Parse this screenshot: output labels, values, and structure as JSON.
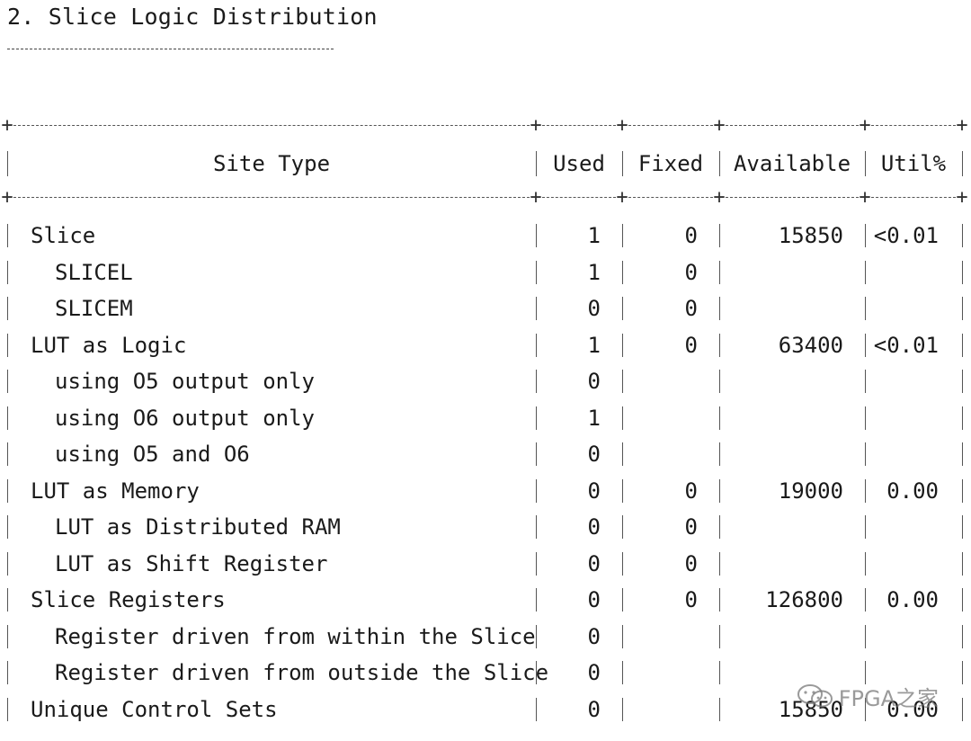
{
  "section": {
    "title": "2. Slice Logic Distribution"
  },
  "table": {
    "headers": {
      "site_type": "Site Type",
      "used": "Used",
      "fixed": "Fixed",
      "available": "Available",
      "util": "Util%"
    },
    "rows": [
      {
        "name": "Slice",
        "indent": false,
        "used": "1",
        "fixed": "0",
        "available": "15850",
        "util": "<0.01"
      },
      {
        "name": "SLICEL",
        "indent": true,
        "used": "1",
        "fixed": "0",
        "available": "",
        "util": ""
      },
      {
        "name": "SLICEM",
        "indent": true,
        "used": "0",
        "fixed": "0",
        "available": "",
        "util": ""
      },
      {
        "name": "LUT as Logic",
        "indent": false,
        "used": "1",
        "fixed": "0",
        "available": "63400",
        "util": "<0.01"
      },
      {
        "name": "using O5 output only",
        "indent": true,
        "used": "0",
        "fixed": "",
        "available": "",
        "util": ""
      },
      {
        "name": "using O6 output only",
        "indent": true,
        "used": "1",
        "fixed": "",
        "available": "",
        "util": ""
      },
      {
        "name": "using O5 and O6",
        "indent": true,
        "used": "0",
        "fixed": "",
        "available": "",
        "util": ""
      },
      {
        "name": "LUT as Memory",
        "indent": false,
        "used": "0",
        "fixed": "0",
        "available": "19000",
        "util": "0.00"
      },
      {
        "name": "LUT as Distributed RAM",
        "indent": true,
        "used": "0",
        "fixed": "0",
        "available": "",
        "util": ""
      },
      {
        "name": "LUT as Shift Register",
        "indent": true,
        "used": "0",
        "fixed": "0",
        "available": "",
        "util": ""
      },
      {
        "name": "Slice Registers",
        "indent": false,
        "used": "0",
        "fixed": "0",
        "available": "126800",
        "util": "0.00"
      },
      {
        "name": "Register driven from within the Slice",
        "indent": true,
        "used": "0",
        "fixed": "",
        "available": "",
        "util": ""
      },
      {
        "name": "Register driven from outside the Slice",
        "indent": true,
        "used": "0",
        "fixed": "",
        "available": "",
        "util": ""
      },
      {
        "name": "Unique Control Sets",
        "indent": false,
        "used": "0",
        "fixed": "",
        "available": "15850",
        "util": "0.00"
      }
    ]
  },
  "watermark": {
    "text": "FPGA之家",
    "icon": "wechat-icon"
  }
}
